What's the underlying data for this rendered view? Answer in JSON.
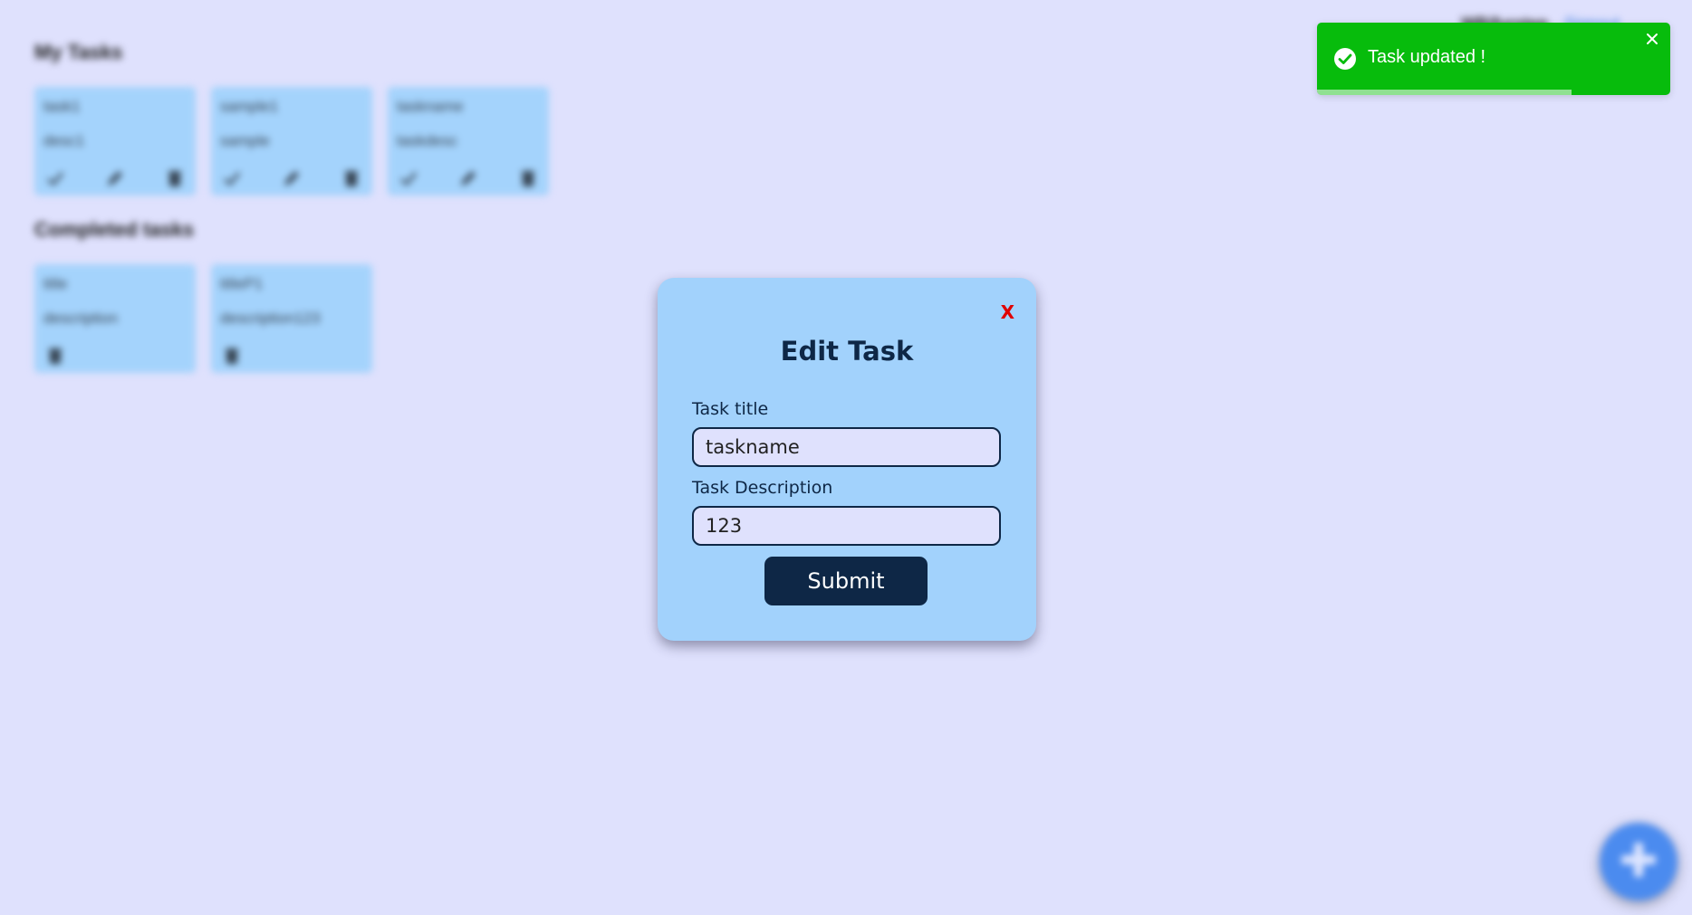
{
  "background": {
    "my_tasks_heading": "My Tasks",
    "completed_heading": "Completed tasks",
    "user": {
      "name": "WBifurstep",
      "logout": "Signout"
    },
    "my_tasks": [
      {
        "title": "task1",
        "description": "desc1"
      },
      {
        "title": "sample1",
        "description": "sample"
      },
      {
        "title": "taskname",
        "description": "taskdesc"
      }
    ],
    "completed_tasks": [
      {
        "title": "title",
        "description": "description"
      },
      {
        "title": "titleP1",
        "description": "description123"
      }
    ],
    "icons": {
      "complete": "check-icon",
      "edit": "pencil-icon",
      "delete": "trash-icon",
      "add": "plus-icon"
    }
  },
  "modal": {
    "close_label": "X",
    "title": "Edit Task",
    "title_label": "Task title",
    "title_value": "taskname",
    "description_label": "Task Description",
    "description_value": "123",
    "submit_label": "Submit"
  },
  "toast": {
    "message": "Task updated !",
    "icon": "check-circle-icon",
    "close_icon": "close-icon",
    "progress": 0.72
  },
  "colors": {
    "page_bg": "#dfe1fd",
    "card_bg": "#a4d3fc",
    "modal_bg": "#a2d2fc",
    "primary_dark": "#0e2746",
    "close_red": "#e00000",
    "toast_green": "#07bc0c",
    "fab_blue": "#4b8bef"
  }
}
